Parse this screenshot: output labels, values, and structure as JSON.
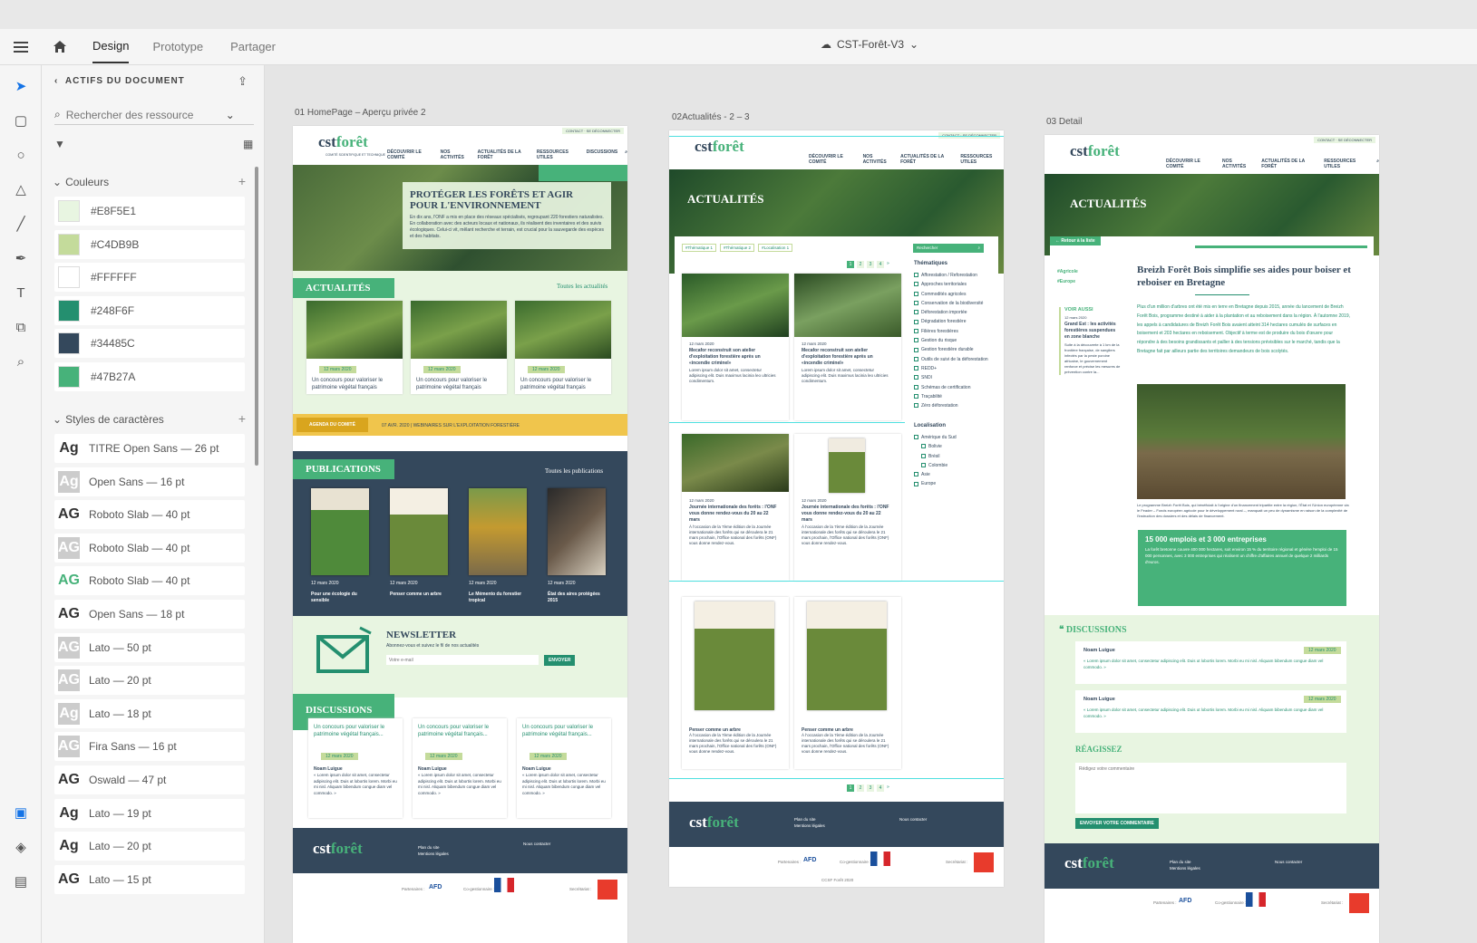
{
  "app": {
    "mode_tabs": [
      "Design",
      "Prototype",
      "Partager"
    ],
    "active_tab": "Design",
    "document_title": "CST-Forêt-V3"
  },
  "panel": {
    "header": "ACTIFS DU DOCUMENT",
    "search_placeholder": "Rechercher des ressource",
    "colors_title": "Couleurs",
    "colors": [
      "#E8F5E1",
      "#C4DB9B",
      "#FFFFFF",
      "#248F6F",
      "#34485C",
      "#47B27A"
    ],
    "char_styles_title": "Styles de caractères",
    "char_styles": [
      {
        "glyph": "Ag",
        "label": "TITRE Open Sans — 26 pt",
        "style": "normal"
      },
      {
        "glyph": "Ag",
        "label": "Open Sans — 16 pt",
        "style": "grey"
      },
      {
        "glyph": "AG",
        "label": "Roboto Slab — 40 pt",
        "style": "normal"
      },
      {
        "glyph": "AG",
        "label": "Roboto Slab — 40 pt",
        "style": "grey"
      },
      {
        "glyph": "AG",
        "label": "Roboto Slab — 40 pt",
        "style": "green"
      },
      {
        "glyph": "AG",
        "label": "Open Sans — 18 pt",
        "style": "normal"
      },
      {
        "glyph": "AG",
        "label": "Lato — 50 pt",
        "style": "grey"
      },
      {
        "glyph": "AG",
        "label": "Lato — 20 pt",
        "style": "grey"
      },
      {
        "glyph": "Ag",
        "label": "Lato — 18 pt",
        "style": "grey"
      },
      {
        "glyph": "AG",
        "label": "Fira Sans — 16 pt",
        "style": "grey"
      },
      {
        "glyph": "AG",
        "label": "Oswald — 47 pt",
        "style": "normal"
      },
      {
        "glyph": "Ag",
        "label": "Lato — 19 pt",
        "style": "normal"
      },
      {
        "glyph": "Ag",
        "label": "Lato — 20 pt",
        "style": "normal"
      },
      {
        "glyph": "AG",
        "label": "Lato — 15 pt",
        "style": "normal"
      }
    ]
  },
  "artboards": {
    "home": {
      "label": "01 HomePage – Aperçu privée 2",
      "topbar_links": [
        "CONTACT",
        "SE DÉCONNECTER"
      ],
      "nav": [
        "DÉCOUVRIR LE COMITÉ",
        "NOS ACTIVITÉS",
        "ACTUALITÉS DE LA FORÊT",
        "RESSOURCES UTILES",
        "DISCUSSIONS"
      ],
      "logo_main": "cst",
      "logo_accent": "forêt",
      "logo_sub": "COMITÉ SCIENTIFIQUE ET TECHNIQUE",
      "hero_title": "PROTÉGER LES FORÊTS ET AGIR POUR L'ENVIRONNEMENT",
      "hero_text": "En dix ans, l'ONF a mis en place des réseaux spécialisés, regroupant 220 forestiers naturalistes. En collaboration avec des acteurs locaux et nationaux, ils réalisent des inventaires et des suivis écologiques. Celui-ci vit, mêlant recherche et terrain, est crucial pour la sauvegarde des espèces et des habitats.",
      "news_title": "ACTUALITÉS",
      "news_link": "Toutes les actualités",
      "news_cards": [
        {
          "date": "12 mars 2020",
          "title": "Un concours pour valoriser le patrimoine végétal français"
        },
        {
          "date": "12 mars 2020",
          "title": "Un concours pour valoriser le patrimoine végétal français"
        },
        {
          "date": "12 mars 2020",
          "title": "Un concours pour valoriser le patrimoine végétal français"
        }
      ],
      "agenda_label": "AGENDA DU COMITÉ",
      "agenda_text": "07 AVR. 2020 | WEBINAIRES SUR L'EXPLOITATION FORESTIÈRE",
      "pub_title": "PUBLICATIONS",
      "pub_link": "Toutes les publications",
      "pubs": [
        {
          "date": "12 mars 2020",
          "title": "Pour une écologie du sensible"
        },
        {
          "date": "12 mars 2020",
          "title": "Penser comme un arbre"
        },
        {
          "date": "12 mars 2020",
          "title": "Le Mémento du forestier tropical"
        },
        {
          "date": "12 mars 2020",
          "title": "État des aires protégées 2015"
        }
      ],
      "newsletter_title": "NEWSLETTER",
      "newsletter_text": "Abonnez-vous et suivez le fil de nos actualités",
      "newsletter_placeholder": "Votre e-mail",
      "newsletter_button": "ENVOYER",
      "disc_title": "DISCUSSIONS",
      "disc_cards": [
        {
          "title": "Un concours pour valoriser le patrimoine végétal français...",
          "date": "12 mars 2020",
          "author": "Noam Luigue",
          "text": "« Lorem ipsum dolor sit amet, consectetur adipiscing elit. Duis ut lobortis lorem. Morbi eu mi nisl. Aliquam bibendum congue diam vel commodo. »"
        },
        {
          "title": "Un concours pour valoriser le patrimoine végétal français...",
          "date": "12 mars 2020",
          "author": "Noam Luigue",
          "text": "« Lorem ipsum dolor sit amet, consectetur adipiscing elit. Duis ut lobortis lorem. Morbi eu mi nisl. Aliquam bibendum congue diam vel commodo. »"
        },
        {
          "title": "Un concours pour valoriser le patrimoine végétal français...",
          "date": "12 mars 2020",
          "author": "Noam Luigue",
          "text": "« Lorem ipsum dolor sit amet, consectetur adipiscing elit. Duis ut lobortis lorem. Morbi eu mi nisl. Aliquam bibendum congue diam vel commodo. »"
        }
      ],
      "footer_links": [
        "Plan du site",
        "Mentions légales",
        "Nous contacter"
      ],
      "partners": [
        "Partenaires :",
        "AFD",
        "Co-gestionnaire :",
        "Secrétariat :"
      ]
    },
    "news": {
      "label": "02Actualités - 2 – 3",
      "hero_title": "ACTUALITÉS",
      "tags": [
        "#Thématique 1",
        "#Thématique 2",
        "#Localisation 1"
      ],
      "search_placeholder": "Rechercher",
      "pages": [
        "1",
        "2",
        "3",
        "4"
      ],
      "themes_title": "Thématiques",
      "themes": [
        "Afforestation / Reforestation",
        "Approches territoriales",
        "Commodités agricoles",
        "Conservation de la biodiversité",
        "Déforestation importée",
        "Dégradation forestière",
        "Filières forestières",
        "Gestion du risque",
        "Gestion forestière durable",
        "Outils de suivi de la déforestation",
        "REDD+",
        "SNDI",
        "Schémas de certification",
        "Traçabilité",
        "Zéro déforestation"
      ],
      "loc_title": "Localisation",
      "locs": [
        "Amérique du Sud",
        "Bolivie",
        "Brésil",
        "Colombie",
        "Asie",
        "Europe"
      ],
      "cards": [
        {
          "date": "12 mars 2020",
          "title": "Mecafor reconstruit son atelier d'exploitation forestière après un «incendie criminel»",
          "text": "Lorem ipsum dolor sit amet, consectetur adipiscing elit. Duis maximus lacinia leo ultricies condimentum."
        },
        {
          "date": "12 mars 2020",
          "title": "Mecafor reconstruit son atelier d'exploitation forestière après un «incendie criminel»",
          "text": "Lorem ipsum dolor sit amet, consectetur adipiscing elit. Duis maximus lacinia leo ultricies condimentum."
        },
        {
          "date": "12 mars 2020",
          "title": "Journée internationale des forêts : l'ONF vous donne rendez-vous du 20 au 22 mars",
          "text": "À l'occasion de la 7ème édition de la Journée internationale des forêts qui se déroulera le 21 mars prochain, l'Office national des forêts (ONF) vous donne rendez-vous."
        },
        {
          "date": "12 mars 2020",
          "title": "Journée internationale des forêts : l'ONF vous donne rendez-vous du 20 au 22 mars",
          "text": "À l'occasion de la 7ème édition de la Journée internationale des forêts qui se déroulera le 21 mars prochain, l'Office national des forêts (ONF) vous donne rendez-vous."
        },
        {
          "date": "",
          "title": "Penser comme un arbre",
          "text": "À l'occasion de la 7ème édition de la Journée internationale des forêts qui se déroulera le 21 mars prochain, l'Office national des forêts (ONF) vous donne rendez-vous."
        },
        {
          "date": "",
          "title": "Penser comme un arbre",
          "text": "À l'occasion de la 7ème édition de la Journée internationale des forêts qui se déroulera le 21 mars prochain, l'Office national des forêts (ONF) vous donne rendez-vous."
        }
      ],
      "copyright": "CCSF Forêt 2020"
    },
    "detail": {
      "label": "03 Detail",
      "hero_title": "ACTUALITÉS",
      "back_link": "Retour à la liste",
      "tags": [
        "#Agricole",
        "#Europe"
      ],
      "see_also": "VOIR AUSSI",
      "see_also_date": "12 mars 2020",
      "see_also_title": "Grand Est : les activités forestières suspendues en zone blanche",
      "see_also_text": "Suite à la découverte à 1 km de la frontière française, de sangliers infectés par la peste porcine africaine, le gouvernement renforce et précise les mesures de prévention contre la...",
      "title": "Breizh Forêt Bois simplifie ses aides pour boiser et reboiser en Bretagne",
      "lead": "Plus d'un million d'arbres ont été mis en terre en Bretagne depuis 2015, année du lancement de Breizh Forêt Bois, programme destiné à aider à la plantation et au reboisement dans la région. À l'automne 2019, les appels à candidatures de Breizh Forêt Bois avaient atteint 314 hectares cumulés de surfaces en boisement et 203 hectares en reboisement. Objectif à terme est de produire du bois d'œuvre pour répondre à des besoins grandissants et pallier à des tensions prévisibles sur le marché, tandis que la Bretagne fait par ailleurs partie des territoires demandeurs de bois scolytés.",
      "caption": "Le programme Breizh Forêt Bois, qui bénéficiait à l'origine d'un financement tripartite entre la région, l'État et l'Union européenne via le Feader – Fonds européen agricole pour le développement rural –, manquait un peu de dynamisme en raison de la complexité de l'instruction des dossiers et des délais de financement.",
      "quote_title": "15 000 emplois et 3 000 entreprises",
      "quote_text": "La forêt bretonne couvre 400 000 hectares, soit environ 15 % du territoire régional et génère l'emploi de 15 000 personnes, avec 3 000 entreprises qui réalisent un chiffre d'affaires annuel de quelque 2 milliards d'euros.",
      "disc_title": "DISCUSSIONS",
      "comments": [
        {
          "author": "Noam Luigue",
          "date": "12 mars 2020",
          "text": "« Lorem ipsum dolor sit amet, consectetur adipiscing elit. Duis ut lobortis lorem. Morbi eu mi nisl. Aliquam bibendum congue diam vel commodo. »"
        },
        {
          "author": "Noam Luigue",
          "date": "12 mars 2020",
          "text": "« Lorem ipsum dolor sit amet, consectetur adipiscing elit. Duis ut lobortis lorem. Morbi eu mi nisl. Aliquam bibendum congue diam vel commodo. »"
        }
      ],
      "react_title": "RÉAGISSEZ",
      "comment_placeholder": "Rédigez votre commentaire",
      "comment_button": "ENVOYER VOTRE COMMENTAIRE"
    }
  }
}
